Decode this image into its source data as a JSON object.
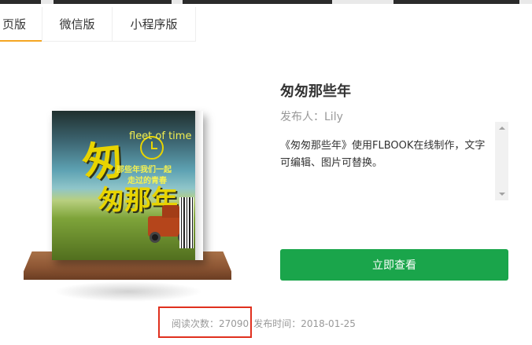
{
  "tabs": [
    {
      "label": "页版",
      "active": true
    },
    {
      "label": "微信版",
      "active": false
    },
    {
      "label": "小程序版",
      "active": false
    }
  ],
  "book": {
    "title": "匆匆那些年",
    "publisher": "发布人：Lily",
    "description": "《匆匆那些年》使用FLBOOK在线制作，文字可编辑、图片可替换。",
    "cover": {
      "big_char": "匆",
      "eng_text": "fleet of time",
      "line1": "那些年我们一起",
      "line2": "走过的青春",
      "big_char2": "匆那年"
    }
  },
  "actions": {
    "view_label": "立即查看"
  },
  "stats": {
    "reads": "阅读次数：27090",
    "published": "发布时间：2018-01-25"
  },
  "colors": {
    "accent_tab": "#f5a623",
    "button_green": "#1aa54b",
    "highlight_red": "#e0301e"
  }
}
